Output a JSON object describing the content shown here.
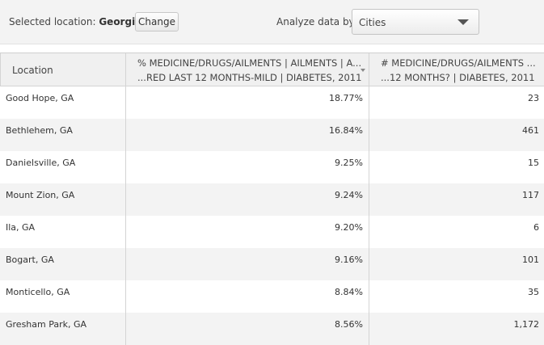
{
  "location_bar": {
    "selected_label": "Selected location:",
    "selected_value": "Georgia",
    "change_button": "Change",
    "analyze_label": "Analyze data by:",
    "analyze_value": "Cities"
  },
  "table": {
    "columns": [
      {
        "label": "Location"
      },
      {
        "line1": "% MEDICINE/DRUGS/AILMENTS | AILMENTS | A...",
        "line2": "...RED LAST 12 MONTHS-MILD | DIABETES, 2011"
      },
      {
        "line1": "# MEDICINE/DRUGS/AILMENTS ...",
        "line2": "...12 MONTHS? | DIABETES, 2011"
      }
    ],
    "rows": [
      {
        "location": "Good Hope, GA",
        "pct": "18.77%",
        "count": "23"
      },
      {
        "location": "Bethlehem, GA",
        "pct": "16.84%",
        "count": "461"
      },
      {
        "location": "Danielsville, GA",
        "pct": "9.25%",
        "count": "15"
      },
      {
        "location": "Mount Zion, GA",
        "pct": "9.24%",
        "count": "117"
      },
      {
        "location": "Ila, GA",
        "pct": "9.20%",
        "count": "6"
      },
      {
        "location": "Bogart, GA",
        "pct": "9.16%",
        "count": "101"
      },
      {
        "location": "Monticello, GA",
        "pct": "8.84%",
        "count": "35"
      },
      {
        "location": "Gresham Park, GA",
        "pct": "8.56%",
        "count": "1,172"
      }
    ]
  }
}
